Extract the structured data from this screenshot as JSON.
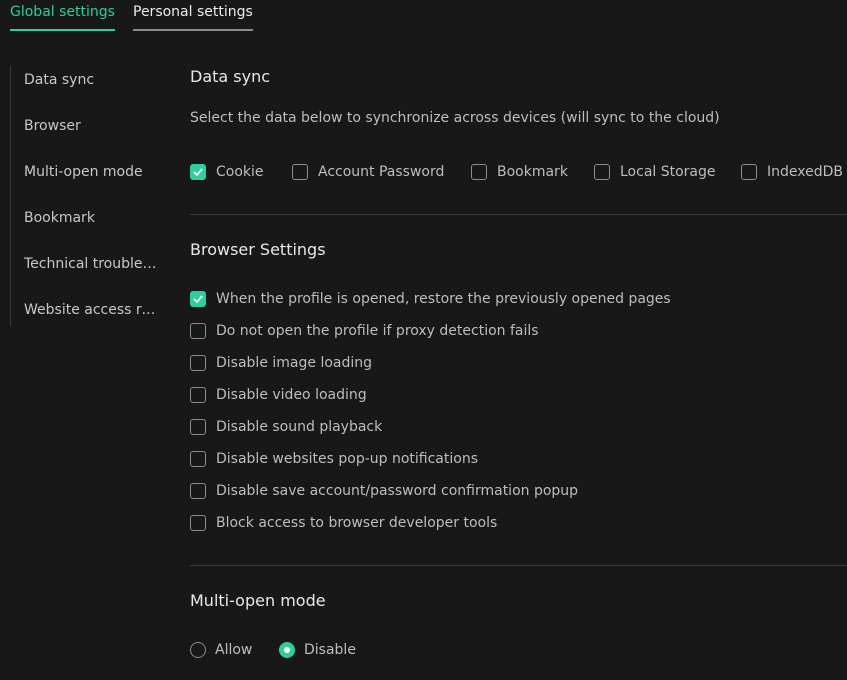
{
  "tabs": {
    "global": "Global settings",
    "personal": "Personal settings"
  },
  "sidebar": {
    "items": [
      {
        "label": "Data sync"
      },
      {
        "label": "Browser"
      },
      {
        "label": "Multi-open mode"
      },
      {
        "label": "Bookmark"
      },
      {
        "label": "Technical troubles..."
      },
      {
        "label": "Website access re..."
      }
    ]
  },
  "data_sync": {
    "title": "Data sync",
    "description": "Select the data below to synchronize across devices (will sync to the cloud)",
    "options": [
      {
        "label": "Cookie",
        "checked": true
      },
      {
        "label": "Account Password",
        "checked": false
      },
      {
        "label": "Bookmark",
        "checked": false
      },
      {
        "label": "Local Storage",
        "checked": false
      },
      {
        "label": "IndexedDB",
        "checked": false
      }
    ]
  },
  "browser_settings": {
    "title": "Browser Settings",
    "options": [
      {
        "label": "When the profile is opened, restore the previously opened pages",
        "checked": true
      },
      {
        "label": "Do not open the profile if proxy detection fails",
        "checked": false
      },
      {
        "label": "Disable image loading",
        "checked": false
      },
      {
        "label": "Disable video loading",
        "checked": false
      },
      {
        "label": "Disable sound playback",
        "checked": false
      },
      {
        "label": "Disable websites pop-up notifications",
        "checked": false
      },
      {
        "label": "Disable save account/password confirmation popup",
        "checked": false
      },
      {
        "label": "Block access to browser developer tools",
        "checked": false
      }
    ]
  },
  "multi_open": {
    "title": "Multi-open mode",
    "options": [
      {
        "label": "Allow",
        "selected": false
      },
      {
        "label": "Disable",
        "selected": true
      }
    ]
  },
  "colors": {
    "accent": "#2fce9c",
    "background": "#181818"
  }
}
